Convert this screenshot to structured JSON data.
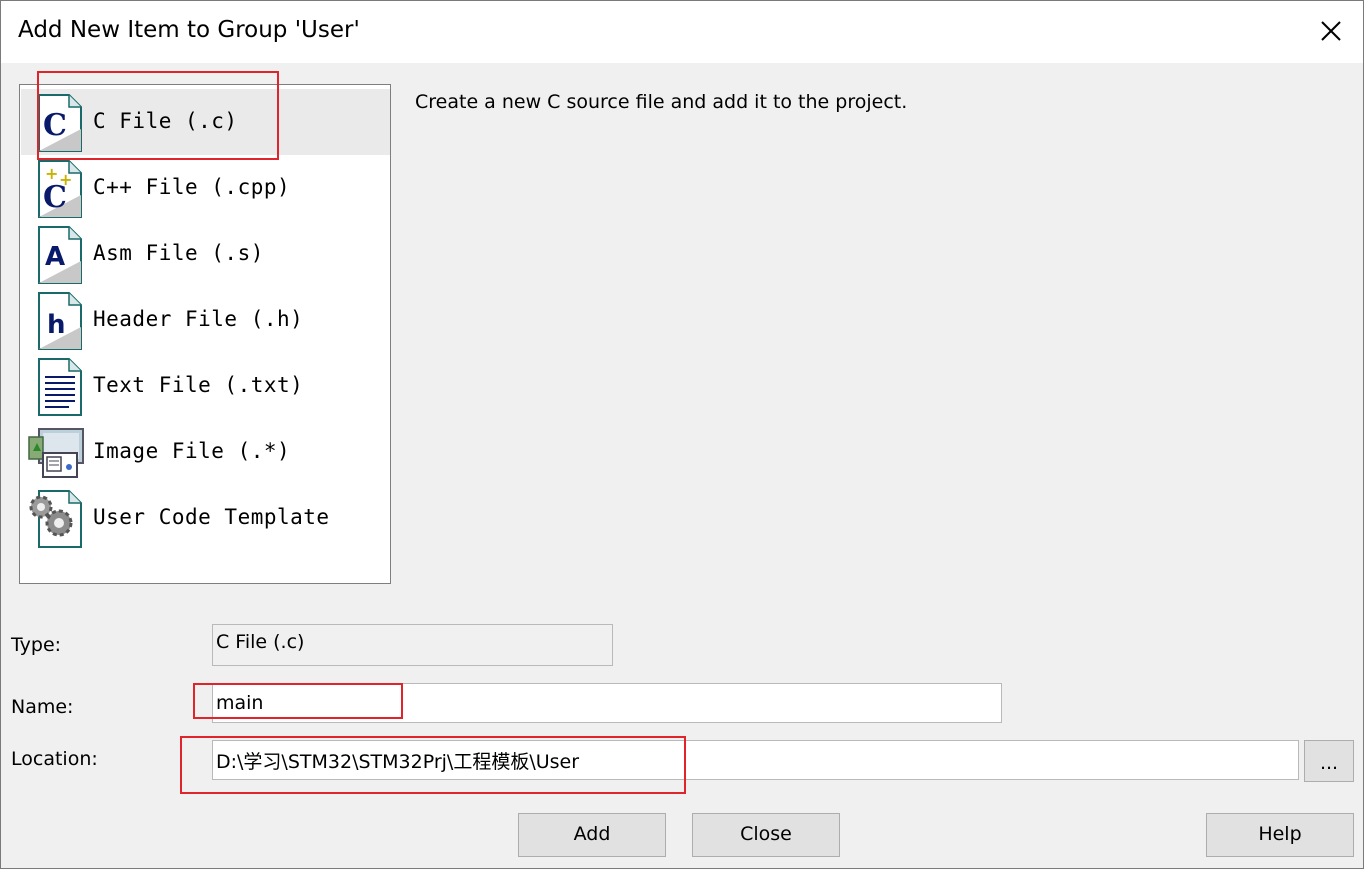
{
  "dialog": {
    "title": "Add New Item to Group 'User'",
    "close_icon": "close-x-icon"
  },
  "file_types": [
    {
      "label": "C File (.c)",
      "icon": "c-file-icon",
      "selected": true
    },
    {
      "label": "C++ File (.cpp)",
      "icon": "cpp-file-icon",
      "selected": false
    },
    {
      "label": "Asm File (.s)",
      "icon": "asm-file-icon",
      "selected": false
    },
    {
      "label": "Header File (.h)",
      "icon": "header-file-icon",
      "selected": false
    },
    {
      "label": "Text File (.txt)",
      "icon": "text-file-icon",
      "selected": false
    },
    {
      "label": "Image File (.*)",
      "icon": "image-file-icon",
      "selected": false
    },
    {
      "label": "User Code Template",
      "icon": "gear-template-icon",
      "selected": false
    }
  ],
  "description": "Create a new C source file and add it to the project.",
  "form": {
    "type_label": "Type:",
    "type_value": "C File (.c)",
    "name_label": "Name:",
    "name_value": "main",
    "location_label": "Location:",
    "location_value": "D:\\学习\\STM32\\STM32Prj\\工程模板\\User",
    "browse_label": "..."
  },
  "buttons": {
    "add": "Add",
    "close": "Close",
    "help": "Help"
  },
  "colors": {
    "highlight_annotation": "#e0242b",
    "selected_row": "#eaeaea",
    "dialog_bg": "#f0f0f0"
  }
}
